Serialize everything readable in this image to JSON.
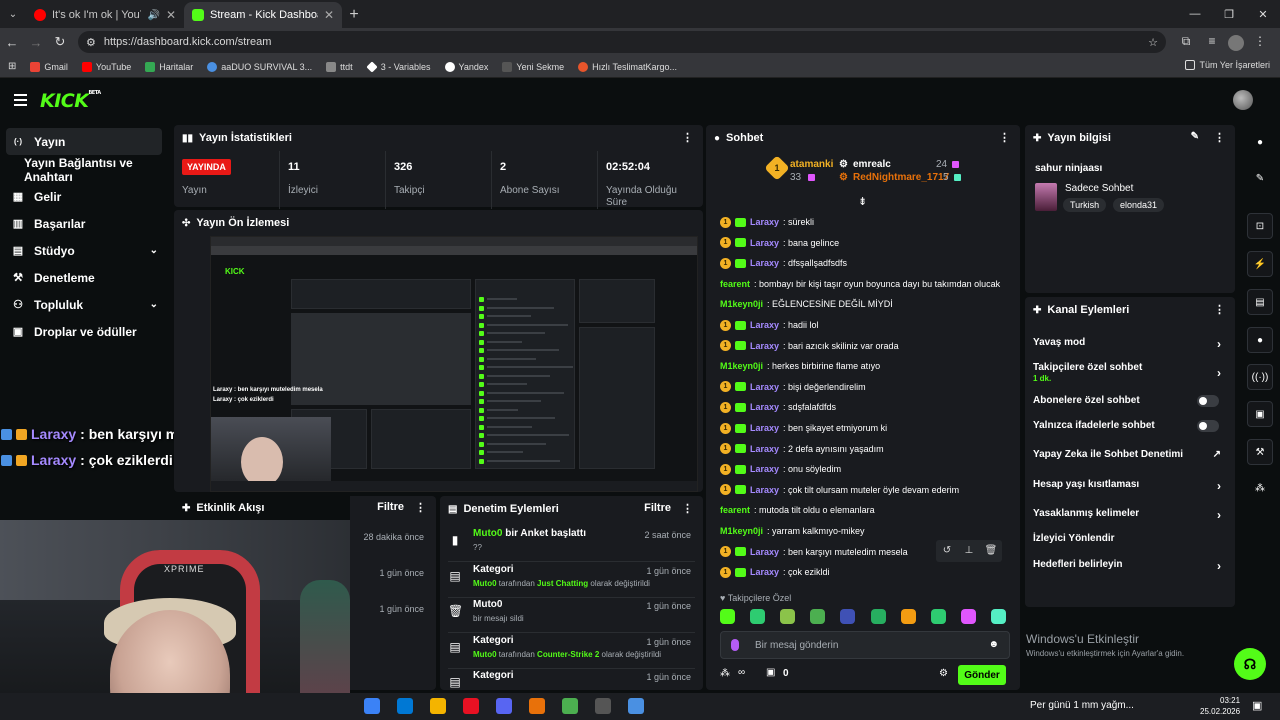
{
  "browser": {
    "tabs": [
      {
        "title": "It's ok I'm ok | YouTube Mu",
        "active": false,
        "favicon_color": "#ff0000"
      },
      {
        "title": "Stream - Kick Dashboard",
        "active": true,
        "favicon_color": "#53fc18"
      }
    ],
    "url": "https://dashboard.kick.com/stream",
    "bookmarks": [
      {
        "label": "Gmail",
        "color": "#ea4335"
      },
      {
        "label": "YouTube",
        "color": "#ff0000"
      },
      {
        "label": "Haritalar",
        "color": "#34a853"
      },
      {
        "label": "aaDUO SURVIVAL 3...",
        "color": "#4a90e2"
      },
      {
        "label": "ttdt",
        "color": "#888888"
      },
      {
        "label": "3 - Variables",
        "color": "#ffffff"
      },
      {
        "label": "Yandex",
        "color": "#ffffff"
      },
      {
        "label": "Yeni Sekme",
        "color": "#888888"
      },
      {
        "label": "Hızlı TeslimatKargo...",
        "color": "#e8552b"
      }
    ],
    "bookmarks_all": "Tüm Yer İşaretleri"
  },
  "header": {
    "logo": "KICK",
    "logo_beta": "BETA"
  },
  "sidebar": {
    "items": [
      {
        "label": "Yayın",
        "icon": "live-icon",
        "glyph": "((·))",
        "active": true
      },
      {
        "label": "Yayın Bağlantısı ve Anahtarı",
        "sub": true
      },
      {
        "label": "Gelir",
        "icon": "revenue-icon",
        "glyph": "▦"
      },
      {
        "label": "Başarılar",
        "icon": "achievements-icon",
        "glyph": "▥"
      },
      {
        "label": "Stüdyo",
        "icon": "studio-icon",
        "glyph": "▤",
        "chevron": true
      },
      {
        "label": "Denetleme",
        "icon": "wrench-icon",
        "glyph": "🔧"
      },
      {
        "label": "Topluluk",
        "icon": "community-icon",
        "glyph": "👥",
        "chevron": true
      },
      {
        "label": "Droplar ve ödüller",
        "icon": "drops-icon",
        "glyph": "🎁"
      }
    ]
  },
  "overlay_chat": [
    {
      "user": "Laraxy",
      "text": ": ben karşıyı muteledim mesela"
    },
    {
      "user": "Laraxy",
      "text": ": çok eziklerdi"
    }
  ],
  "webcam": {
    "chair_brand": "XPRIME"
  },
  "stats_panel": {
    "title": "Yayın İstatistikleri",
    "items": [
      {
        "value": "YAYINDA",
        "label": "Yayın",
        "live": true
      },
      {
        "value": "11",
        "label": "İzleyici"
      },
      {
        "value": "326",
        "label": "Takipçi"
      },
      {
        "value": "2",
        "label": "Abone Sayısı"
      },
      {
        "value": "02:52:04",
        "label": "Yayında Olduğu Süre"
      }
    ]
  },
  "preview_panel": {
    "title": "Yayın Ön İzlemesi",
    "mini_overlay": [
      "Laraxy : ben karşıyı muteledim mesela",
      "Laraxy : çok eziklerdi"
    ]
  },
  "activity_panel": {
    "title": "Etkinlik Akışı",
    "filter": "Filtre",
    "rows": [
      {
        "time": "28 dakika önce"
      },
      {
        "time": "1 gün önce"
      },
      {
        "time": "1 gün önce"
      }
    ]
  },
  "mod_panel": {
    "title": "Denetim Eylemleri",
    "filter": "Filtre",
    "rows": [
      {
        "icon": "poll-icon",
        "glyph": "▮",
        "user": "Muto0",
        "title": " bir Anket başlattı",
        "sub": "??",
        "time": "2 saat önce"
      },
      {
        "icon": "category-icon",
        "glyph": "▤",
        "title": "Kategori",
        "sub_user": "Muto0",
        "sub_mid": " tarafından ",
        "sub_val": "Just Chatting",
        "sub_end": " olarak değiştirildi",
        "time": "1 gün önce"
      },
      {
        "icon": "trash-icon",
        "glyph": "🗑",
        "title": "Muto0",
        "sub": "bir mesajı sildi",
        "time": "1 gün önce"
      },
      {
        "icon": "category-icon",
        "glyph": "▤",
        "title": "Kategori",
        "sub_user": "Muto0",
        "sub_mid": " tarafından ",
        "sub_val": "Counter-Strike 2",
        "sub_end": " olarak değiştirildi",
        "time": "1 gün önce"
      },
      {
        "icon": "category-icon",
        "glyph": "▤",
        "title": "Kategori",
        "time": "1 gün önce"
      }
    ]
  },
  "chat_panel": {
    "title": "Sohbet",
    "pinned": {
      "rank": "1",
      "top1_name": "atamanki",
      "top1_count": "33",
      "top2_name": "emrealc",
      "top2_count": "24",
      "top3_name": "RedNightmare_1717",
      "top3_count": "5"
    },
    "messages": [
      {
        "user": "Laraxy",
        "text": ": sürekli",
        "color": "#a58aff",
        "badges": true
      },
      {
        "user": "Laraxy",
        "text": ": bana gelince",
        "color": "#a58aff",
        "badges": true
      },
      {
        "user": "Laraxy",
        "text": ": dfsşallşadfsdfs",
        "color": "#a58aff",
        "badges": true
      },
      {
        "user": "fearent",
        "text": ": bombayı bir kişi taşır oyun boyunca dayı bu takımdan olucak",
        "color": "#53fc18",
        "badges": false
      },
      {
        "user": "M1keyn0ji",
        "text": ": EĞLENCESİNE DEĞİL MİYDİ",
        "color": "#53fc18",
        "badges": false
      },
      {
        "user": "Laraxy",
        "text": ": hadii lol",
        "color": "#a58aff",
        "badges": true
      },
      {
        "user": "Laraxy",
        "text": ": bari azıcık skiliniz var orada",
        "color": "#a58aff",
        "badges": true
      },
      {
        "user": "M1keyn0ji",
        "text": ": herkes birbirine flame atıyo",
        "color": "#53fc18",
        "badges": false
      },
      {
        "user": "Laraxy",
        "text": ": bişi değerlendirelim",
        "color": "#a58aff",
        "badges": true
      },
      {
        "user": "Laraxy",
        "text": ": sdşfalafdfds",
        "color": "#a58aff",
        "badges": true
      },
      {
        "user": "Laraxy",
        "text": ": ben şikayet etmiyorum ki",
        "color": "#a58aff",
        "badges": true
      },
      {
        "user": "Laraxy",
        "text": ": 2 defa aynısını yaşadım",
        "color": "#a58aff",
        "badges": true
      },
      {
        "user": "Laraxy",
        "text": ": onu söyledim",
        "color": "#a58aff",
        "badges": true
      },
      {
        "user": "Laraxy",
        "text": ": çok tilt olursam muteler öyle devam ederim",
        "color": "#a58aff",
        "badges": true
      },
      {
        "user": "fearent",
        "text": ": mutoda tilt oldu o elemanlara",
        "color": "#53fc18",
        "badges": false
      },
      {
        "user": "M1keyn0ji",
        "text": ": yarram kalkmıyo-mikey",
        "color": "#53fc18",
        "badges": false
      },
      {
        "user": "Laraxy",
        "text": ": ben karşıyı muteledim mesela",
        "color": "#a58aff",
        "badges": true,
        "hover": true
      },
      {
        "user": "Laraxy",
        "text": ": çok ezikldi",
        "color": "#a58aff",
        "badges": true
      }
    ],
    "followers_only": "Takipçilere Özel",
    "emote_colors": [
      "#53fc18",
      "#2ecc71",
      "#8bc34a",
      "#4caf50",
      "#3f51b5",
      "#27ae60",
      "#f39c12",
      "#2ecc71",
      "#e056fd",
      "#55efc4"
    ],
    "input_placeholder": "Bir mesaj gönderin",
    "points_label": "∞",
    "count": "0",
    "send_label": "Gönder"
  },
  "stream_info": {
    "title": "Yayın bilgisi",
    "stream_title": "sahur ninjaası",
    "category": "Sadece Sohbet",
    "tags": [
      "Turkish",
      "elonda31"
    ]
  },
  "channel_actions": {
    "title": "Kanal Eylemleri",
    "rows": [
      {
        "label": "Yavaş mod",
        "kind": "arrow"
      },
      {
        "label": "Takipçilere özel sohbet",
        "sub": "1 dk.",
        "kind": "arrow"
      },
      {
        "label": "Abonelere özel sohbet",
        "kind": "toggle"
      },
      {
        "label": "Yalnızca ifadelerle sohbet",
        "kind": "toggle"
      },
      {
        "label": "Yapay Zeka ile Sohbet Denetimi",
        "kind": "external"
      },
      {
        "label": "Hesap yaşı kısıtlaması",
        "kind": "arrow"
      },
      {
        "label": "Yasaklanmış kelimeler",
        "kind": "arrow"
      },
      {
        "label": "İzleyici Yönlendir",
        "kind": "none"
      },
      {
        "label": "Hedefleri belirleyin",
        "kind": "arrow"
      }
    ]
  },
  "windows_activation": {
    "title": "Windows'u Etkinleştir",
    "sub": "Windows'u etkinleştirmek için Ayarlar'a gidin."
  },
  "taskbar": {
    "apps": [
      "#3b82f6",
      "#0078d4",
      "#f4b400",
      "#e81123",
      "#5865f2",
      "#e8710a",
      "#4caf50",
      "#555555",
      "#4a90e2"
    ],
    "weather": "Per günü 1 mm yağm...",
    "time": "03:21",
    "date": "25.02.2026"
  }
}
